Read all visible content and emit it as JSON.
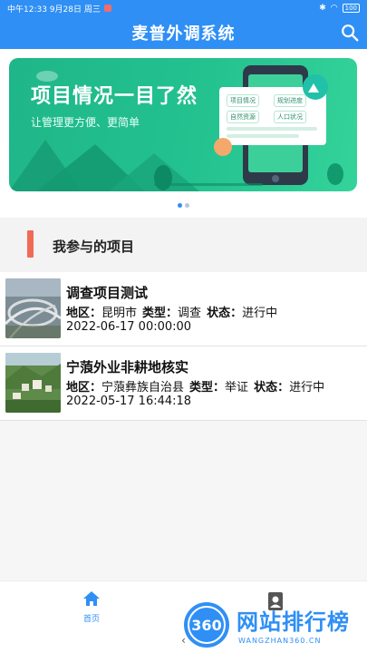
{
  "status_bar": {
    "time_date": "中午12:33  9月28日 周三",
    "battery": "100"
  },
  "app_bar": {
    "title": "麦普外调系统",
    "search_icon": "search-icon"
  },
  "banner": {
    "title": "项目情况一目了然",
    "subtitle": "让管理更方便、更简单",
    "chips": [
      "项目情况",
      "规划进度",
      "自然资源",
      "人口状况"
    ],
    "page_count": 2,
    "active_page": 1
  },
  "section": {
    "title": "我参与的项目"
  },
  "projects": [
    {
      "title": "调查项目测试",
      "region_label": "地区：",
      "region": "昆明市",
      "type_label": "类型：",
      "type": "调查",
      "status_label": "状态：",
      "status": "进行中",
      "date": "2022-06-17 00:00:00",
      "thumb": "highway-interchange-photo"
    },
    {
      "title": "宁蒗外业非耕地核实",
      "region_label": "地区：",
      "region": "宁蒗彝族自治县",
      "type_label": "类型：",
      "type": "举证",
      "status_label": "状态：",
      "status": "进行中",
      "date": "2022-05-17 16:44:18",
      "thumb": "mountain-town-photo"
    }
  ],
  "bottom_nav": {
    "home_label": "首页",
    "home_icon": "home-icon",
    "contact_icon": "contact-icon"
  },
  "system_nav": {
    "back": "‹"
  },
  "watermark": {
    "badge": "360",
    "text": "网站排行榜",
    "sub": "WANGZHAN360.CN"
  },
  "colors": {
    "primary": "#2f8ff5",
    "banner_green": "#23c28f",
    "section_accent": "#f06a55"
  }
}
